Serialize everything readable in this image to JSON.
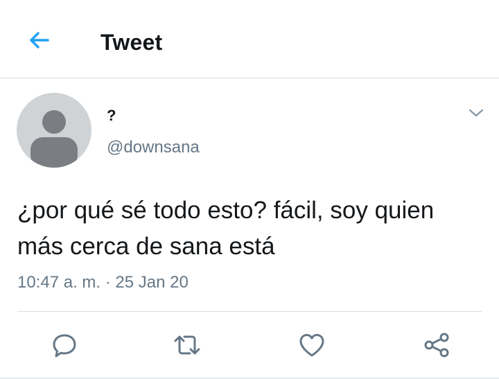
{
  "header": {
    "title": "Tweet",
    "back_icon": "arrow-left-icon"
  },
  "tweet": {
    "display_name": "?",
    "handle": "@downsana",
    "text": "¿por qué sé todo esto? fácil, soy quien más cerca de sana está",
    "timestamp": "10:47 a. m. · 25 Jan 20",
    "menu_icon": "chevron-down-icon"
  },
  "actions": [
    {
      "name": "reply",
      "icon": "reply-icon"
    },
    {
      "name": "retweet",
      "icon": "retweet-icon"
    },
    {
      "name": "like",
      "icon": "heart-icon"
    },
    {
      "name": "share",
      "icon": "share-icon"
    }
  ],
  "colors": {
    "accent": "#1da1f2",
    "text": "#14171a",
    "secondary": "#657786",
    "divider": "#d6dde3",
    "avatar_bg": "#cfd3d6",
    "avatar_fg": "#7a7e82"
  }
}
